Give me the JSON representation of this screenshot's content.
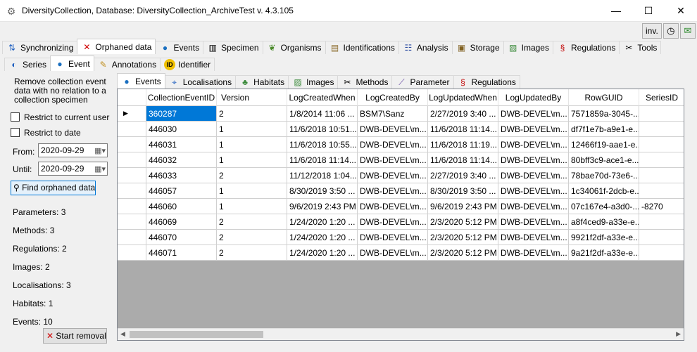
{
  "window": {
    "title": "DiversityCollection,  Database: DiversityCollection_ArchiveTest    v. 4.3.105",
    "minimize": "—",
    "maximize": "☐",
    "close": "✕"
  },
  "toolbar_right": {
    "inv_label": "inv."
  },
  "main_tabs": [
    {
      "label": "Synchronizing",
      "icon": "sync-icon"
    },
    {
      "label": "Orphaned data",
      "icon": "red-x-icon"
    },
    {
      "label": "Events",
      "icon": "globe-icon"
    },
    {
      "label": "Specimen",
      "icon": "barcode-icon"
    },
    {
      "label": "Organisms",
      "icon": "leaf-icon"
    },
    {
      "label": "Identifications",
      "icon": "list-icon"
    },
    {
      "label": "Analysis",
      "icon": "analysis-icon"
    },
    {
      "label": "Storage",
      "icon": "storage-icon"
    },
    {
      "label": "Images",
      "icon": "image-icon"
    },
    {
      "label": "Regulations",
      "icon": "paragraph-icon"
    },
    {
      "label": "Tools",
      "icon": "tools-icon"
    }
  ],
  "sub_tabs": [
    {
      "label": "Series",
      "icon": "series-icon"
    },
    {
      "label": "Event",
      "icon": "globe-icon"
    },
    {
      "label": "Annotations",
      "icon": "annotation-icon"
    },
    {
      "label": "Identifier",
      "icon": "id-icon"
    }
  ],
  "event_tabs": [
    {
      "label": "Events",
      "icon": "globe-icon"
    },
    {
      "label": "Localisations",
      "icon": "localisation-icon"
    },
    {
      "label": "Habitats",
      "icon": "habitat-icon"
    },
    {
      "label": "Images",
      "icon": "image-icon"
    },
    {
      "label": "Methods",
      "icon": "tools-icon"
    },
    {
      "label": "Parameter",
      "icon": "parameter-icon"
    },
    {
      "label": "Regulations",
      "icon": "paragraph-icon"
    }
  ],
  "left_panel": {
    "description": "Remove collection event data with no relation to a collection specimen",
    "restrict_user_label": "Restrict to current user",
    "restrict_date_label": "Restrict to date",
    "from_label": "From:",
    "from_value": "2020-09-29",
    "until_label": "Until:",
    "until_value": "2020-09-29",
    "find_button": "Find orphaned data",
    "counts": [
      "Parameters: 3",
      "Methods: 3",
      "Regulations: 2",
      "Images: 2",
      "Localisations: 3",
      "Habitats: 1",
      "Events: 10"
    ],
    "start_button": "Start removal"
  },
  "grid": {
    "columns": [
      "CollectionEventID",
      "Version",
      "LogCreatedWhen",
      "LogCreatedBy",
      "LogUpdatedWhen",
      "LogUpdatedBy",
      "RowGUID",
      "SeriesID"
    ],
    "rows": [
      [
        "360287",
        "2",
        "1/8/2014 11:06 ...",
        "BSM7\\Sanz",
        "2/27/2019 3:40 ...",
        "DWB-DEVEL\\m...",
        "7571859a-3045-...",
        ""
      ],
      [
        "446030",
        "1",
        "11/6/2018 10:51...",
        "DWB-DEVEL\\m...",
        "11/6/2018 11:14...",
        "DWB-DEVEL\\m...",
        "df7f1e7b-a9e1-e...",
        ""
      ],
      [
        "446031",
        "1",
        "11/6/2018 10:55...",
        "DWB-DEVEL\\m...",
        "11/6/2018 11:19...",
        "DWB-DEVEL\\m...",
        "12466f19-aae1-e...",
        ""
      ],
      [
        "446032",
        "1",
        "11/6/2018 11:14...",
        "DWB-DEVEL\\m...",
        "11/6/2018 11:14...",
        "DWB-DEVEL\\m...",
        "80bff3c9-ace1-e...",
        ""
      ],
      [
        "446033",
        "2",
        "11/12/2018 1:04...",
        "DWB-DEVEL\\m...",
        "2/27/2019 3:40 ...",
        "DWB-DEVEL\\m...",
        "78bae70d-73e6-...",
        ""
      ],
      [
        "446057",
        "1",
        "8/30/2019 3:50 ...",
        "DWB-DEVEL\\m...",
        "8/30/2019 3:50 ...",
        "DWB-DEVEL\\m...",
        "1c34061f-2dcb-e...",
        ""
      ],
      [
        "446060",
        "1",
        "9/6/2019 2:43 PM",
        "DWB-DEVEL\\m...",
        "9/6/2019 2:43 PM",
        "DWB-DEVEL\\m...",
        "07c167e4-a3d0-...",
        "-8270"
      ],
      [
        "446069",
        "2",
        "1/24/2020 1:20 ...",
        "DWB-DEVEL\\m...",
        "2/3/2020 5:12 PM",
        "DWB-DEVEL\\m...",
        "a8f4ced9-a33e-e...",
        ""
      ],
      [
        "446070",
        "2",
        "1/24/2020 1:20 ...",
        "DWB-DEVEL\\m...",
        "2/3/2020 5:12 PM",
        "DWB-DEVEL\\m...",
        "9921f2df-a33e-e...",
        ""
      ],
      [
        "446071",
        "2",
        "1/24/2020 1:20 ...",
        "DWB-DEVEL\\m...",
        "2/3/2020 5:12 PM",
        "DWB-DEVEL\\m...",
        "9a21f2df-a33e-e...",
        ""
      ]
    ]
  },
  "colors": {
    "selection": "#0078d7",
    "grid_background": "#ababab",
    "start_icon": "#d00000"
  }
}
